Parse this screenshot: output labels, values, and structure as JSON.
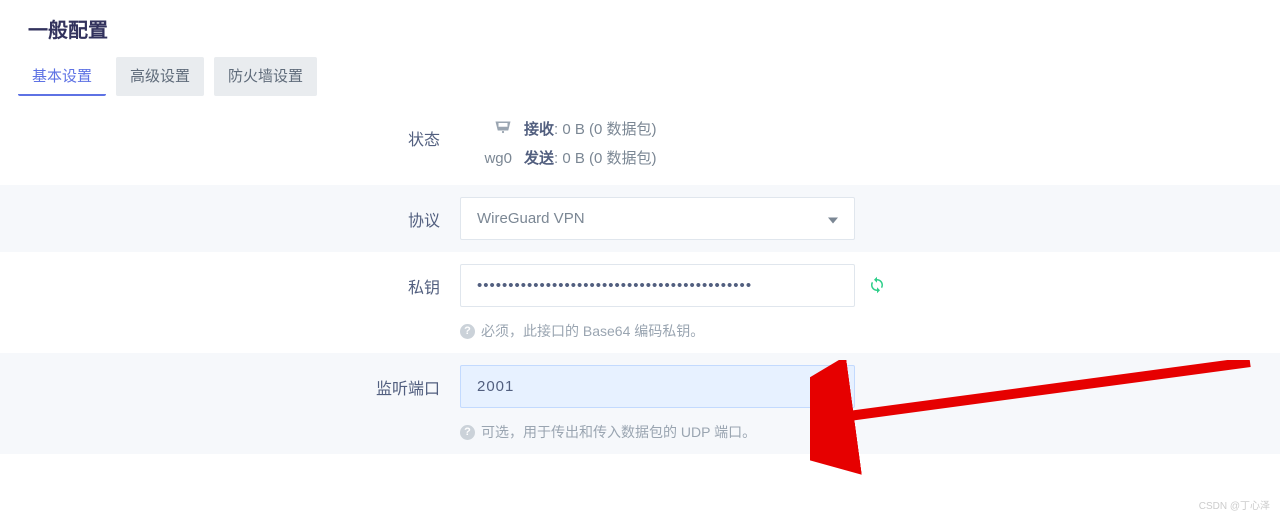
{
  "title": "一般配置",
  "tabs": [
    "基本设置",
    "高级设置",
    "防火墙设置"
  ],
  "status": {
    "label": "状态",
    "interface": "wg0",
    "rx_label": "接收",
    "rx_value": "0 B (0 数据包)",
    "tx_label": "发送",
    "tx_value": "0 B (0 数据包)"
  },
  "protocol": {
    "label": "协议",
    "value": "WireGuard VPN"
  },
  "private_key": {
    "label": "私钥",
    "value": "••••••••••••••••••••••••••••••••••••••••••••",
    "help": "必须，此接口的 Base64 编码私钥。"
  },
  "listen_port": {
    "label": "监听端口",
    "value": "2001",
    "help": "可选，用于传出和传入数据包的 UDP 端口。"
  },
  "watermark": "CSDN @丁心泽"
}
